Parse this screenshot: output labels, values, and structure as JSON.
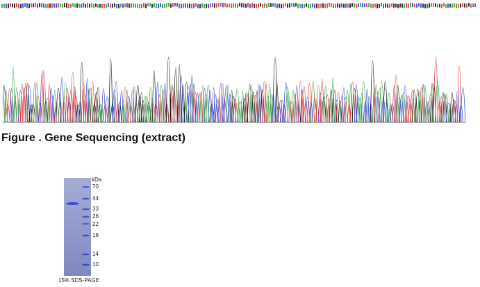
{
  "sequence_trace": {
    "colors": {
      "A": "#2e9e3a",
      "C": "#2a3fd6",
      "G": "#111111",
      "T": "#e23232"
    }
  },
  "figure": {
    "caption": "Figure . Gene Sequencing (extract)"
  },
  "gel": {
    "unit_label": "kDa",
    "markers": [
      "70",
      "44",
      "33",
      "26",
      "22",
      "18",
      "14",
      "10"
    ],
    "caption": "15% SDS-PAGE",
    "lane_color": "#8a93c6",
    "band_color": "#2a44c8"
  }
}
